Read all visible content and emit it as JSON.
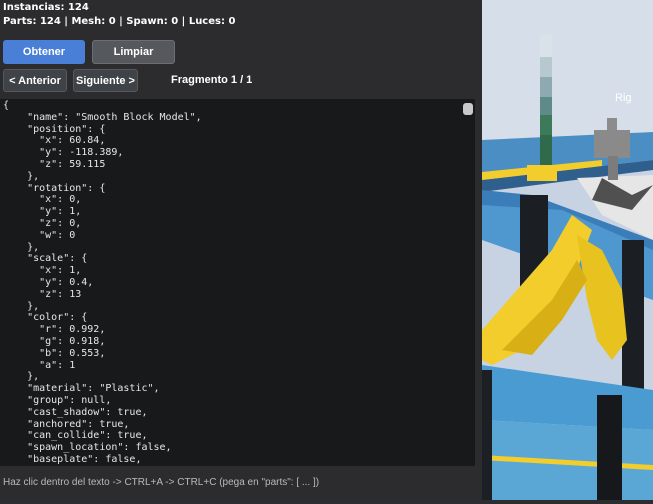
{
  "stats": {
    "instances": "Instancias: 124",
    "counts": "Parts: 124 | Mesh: 0 | Spawn: 0 | Luces: 0"
  },
  "buttons": {
    "fetch": "Obtener",
    "clear": "Limpiar",
    "prev": "< Anterior",
    "next": "Siguiente >"
  },
  "fragment": "Fragmento 1 / 1",
  "json_text": "{\n    \"name\": \"Smooth Block Model\",\n    \"position\": {\n      \"x\": 60.84,\n      \"y\": -118.389,\n      \"z\": 59.115\n    },\n    \"rotation\": {\n      \"x\": 0,\n      \"y\": 1,\n      \"z\": 0,\n      \"w\": 0\n    },\n    \"scale\": {\n      \"x\": 1,\n      \"y\": 0.4,\n      \"z\": 13\n    },\n    \"color\": {\n      \"r\": 0.992,\n      \"g\": 0.918,\n      \"b\": 0.553,\n      \"a\": 1\n    },\n    \"material\": \"Plastic\",\n    \"group\": null,\n    \"cast_shadow\": true,\n    \"anchored\": true,\n    \"can_collide\": true,\n    \"spawn_location\": false,\n    \"baseplate\": false,\n    \"truss\": false",
  "footer": "Haz clic dentro del texto -> CTRL+A -> CTRL+C (pega en \"parts\": [ ... ])",
  "viewport": {
    "rig_label": "Rig"
  },
  "colors": {
    "primary_button": "#4a7fd8",
    "panel_bg": "#2c2c2e",
    "code_bg": "#18191b",
    "sky": "#c8d3e4",
    "baseplate_blue": "#5aa7d6",
    "yellow": "#f2cd2b"
  }
}
